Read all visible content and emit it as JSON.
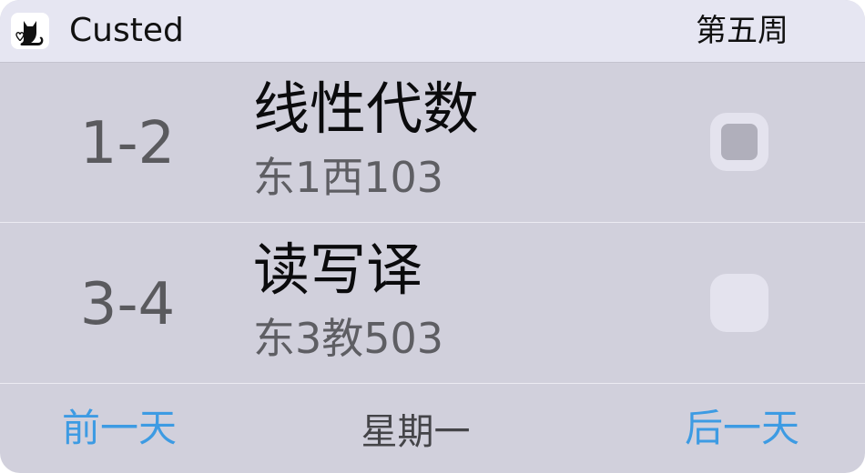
{
  "header": {
    "app_name": "Custed",
    "app_icon": "black-cat-icon",
    "week": "第五周"
  },
  "schedule": [
    {
      "period": "1-2",
      "course": "线性代数",
      "room": "东1西103",
      "checked": true
    },
    {
      "period": "3-4",
      "course": "读写译",
      "room": "东3教503",
      "checked": false
    }
  ],
  "footer": {
    "prev_label": "前一天",
    "day_label": "星期一",
    "next_label": "后一天",
    "accent_color": "#3d9be3"
  }
}
